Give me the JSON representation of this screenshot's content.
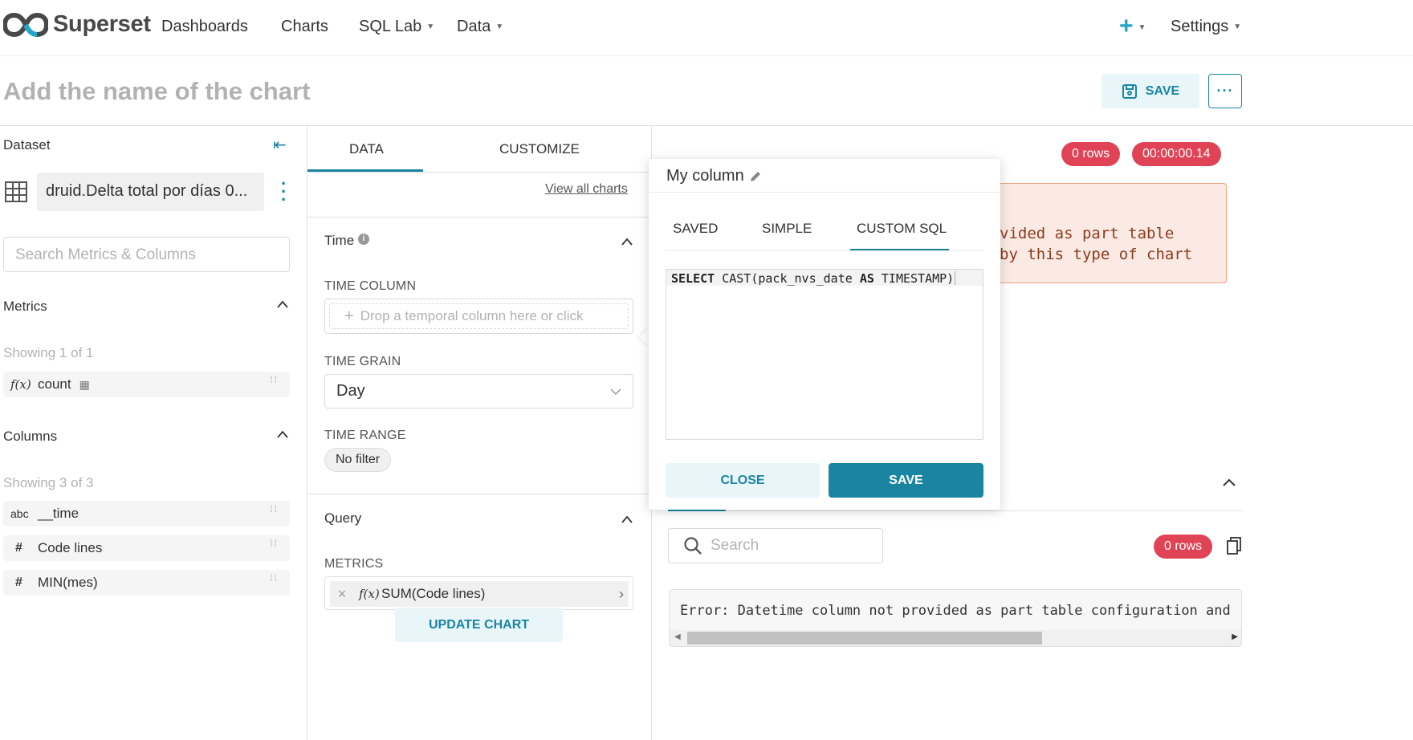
{
  "nav": {
    "brand": "Superset",
    "links": [
      "Dashboards",
      "Charts",
      "SQL Lab",
      "Data"
    ],
    "settings": "Settings"
  },
  "header": {
    "chart_name_placeholder": "Add the name of the chart",
    "save_label": "SAVE",
    "more_label": "···"
  },
  "dataset_panel": {
    "title": "Dataset",
    "dataset_name": "druid.Delta total por días 0...",
    "search_placeholder": "Search Metrics & Columns",
    "metrics_title": "Metrics",
    "metrics_showing": "Showing 1 of 1",
    "metrics": [
      {
        "type": "f(x)",
        "name": "count"
      }
    ],
    "columns_title": "Columns",
    "columns_showing": "Showing 3 of 3",
    "columns": [
      {
        "type": "abc",
        "name": "__time"
      },
      {
        "type": "#",
        "name": "Code lines"
      },
      {
        "type": "#",
        "name": "MIN(mes)"
      }
    ]
  },
  "control_panel": {
    "tabs": [
      "DATA",
      "CUSTOMIZE"
    ],
    "active_tab": "DATA",
    "view_all_charts": "View all charts",
    "time_section": "Time",
    "time_column_label": "TIME COLUMN",
    "time_column_placeholder": "Drop a temporal column here or click",
    "time_grain_label": "TIME GRAIN",
    "time_grain_value": "Day",
    "time_range_label": "TIME RANGE",
    "time_range_value": "No filter",
    "query_section": "Query",
    "metrics_label": "METRICS",
    "metric_value": "SUM(Code lines)",
    "update_chart": "UPDATE CHART"
  },
  "results": {
    "rows_badge": "0 rows",
    "time_badge": "00:00:00.14",
    "alert_line1": "vided as part table",
    "alert_line2": "by this type of chart",
    "search_placeholder": "Search",
    "rows_badge_2": "0 rows",
    "error_text": "Error: Datetime column not provided as part table configuration and"
  },
  "popover": {
    "title": "My column",
    "tabs": [
      "SAVED",
      "SIMPLE",
      "CUSTOM SQL"
    ],
    "active_tab": "CUSTOM SQL",
    "sql_keyword1": "SELECT",
    "sql_middle": "CAST(pack_nvs_date",
    "sql_keyword2": "AS",
    "sql_end": "TIMESTAMP)",
    "close_label": "CLOSE",
    "save_label": "SAVE"
  },
  "colors": {
    "primary": "#1a85a0",
    "primary_light": "#e8f5f9",
    "danger": "#e04355",
    "alert_bg": "#fbeae3"
  }
}
